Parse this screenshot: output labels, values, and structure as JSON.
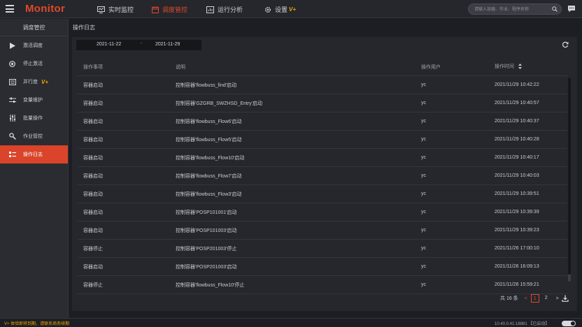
{
  "app": {
    "title": "Monitor"
  },
  "nav": [
    {
      "label": "实时监控",
      "icon": "monitor-icon",
      "active": false
    },
    {
      "label": "调度管控",
      "icon": "calendar-icon",
      "active": true
    },
    {
      "label": "运行分析",
      "icon": "analysis-icon",
      "active": false
    },
    {
      "label": "设置",
      "icon": "gear-icon",
      "badge": "V+",
      "active": false
    }
  ],
  "search": {
    "placeholder": "请输入容器、作业、程序名称"
  },
  "sidebar": {
    "title": "调度管控",
    "items": [
      {
        "label": "激活调度",
        "icon": "play-icon"
      },
      {
        "label": "停止激活",
        "icon": "stop-icon"
      },
      {
        "label": "并行度",
        "icon": "parallel-icon",
        "badge": "V+"
      },
      {
        "label": "变量维护",
        "icon": "sliders-icon"
      },
      {
        "label": "批量操作",
        "icon": "batch-icon"
      },
      {
        "label": "作业管控",
        "icon": "wrench-icon"
      },
      {
        "label": "操作日志",
        "icon": "log-icon",
        "active": true
      }
    ]
  },
  "page": {
    "title": "操作日志"
  },
  "filter": {
    "start_date": "2021-11-22",
    "separator": "-",
    "end_date": "2021-11-29"
  },
  "table": {
    "headers": [
      "操作事项",
      "说明",
      "操作用户",
      "操作时间"
    ],
    "rows": [
      [
        "容器启动",
        "控制容器'flowbuss_find'启动",
        "yc",
        "2021/11/29 10:42:22"
      ],
      [
        "容器启动",
        "控制容器'GZGRB_SWZHSD_Entry'启动",
        "yc",
        "2021/11/29 10:40:57"
      ],
      [
        "容器启动",
        "控制容器'flowbuss_Flow6'启动",
        "yc",
        "2021/11/29 10:40:37"
      ],
      [
        "容器启动",
        "控制容器'flowbuss_Flow5'启动",
        "yc",
        "2021/11/29 10:40:28"
      ],
      [
        "容器启动",
        "控制容器'flowbuss_Flow10'启动",
        "yc",
        "2021/11/29 10:40:17"
      ],
      [
        "容器启动",
        "控制容器'flowbuss_Flow7'启动",
        "yc",
        "2021/11/29 10:40:03"
      ],
      [
        "容器启动",
        "控制容器'flowbuss_Flow3'启动",
        "yc",
        "2021/11/29 10:39:51"
      ],
      [
        "容器启动",
        "控制容器'POSP101001'启动",
        "yc",
        "2021/11/29 10:39:39"
      ],
      [
        "容器启动",
        "控制容器'POSP101003'启动",
        "yc",
        "2021/11/29 10:39:23"
      ],
      [
        "容器停止",
        "控制容器'POSP201003'停止",
        "yc",
        "2021/11/26 17:00:10"
      ],
      [
        "容器启动",
        "控制容器'POSP201003'启动",
        "yc",
        "2021/11/26 16:09:13"
      ],
      [
        "容器停止",
        "控制容器'flowbuss_Flow10'停止",
        "yc",
        "2021/11/26 15:59:21"
      ]
    ]
  },
  "pagination": {
    "total": "共 16 条",
    "prev": "<",
    "pages": [
      "1",
      "2"
    ],
    "current": "1",
    "next": ">"
  },
  "footer": {
    "warning": "V+ 体验即将到期，请联系商务续期",
    "status": "10.40.0.41:18881 【已启动】"
  },
  "colors": {
    "accent": "#e0482b",
    "vplus": "#f0a500",
    "background": "#1c1e23"
  }
}
